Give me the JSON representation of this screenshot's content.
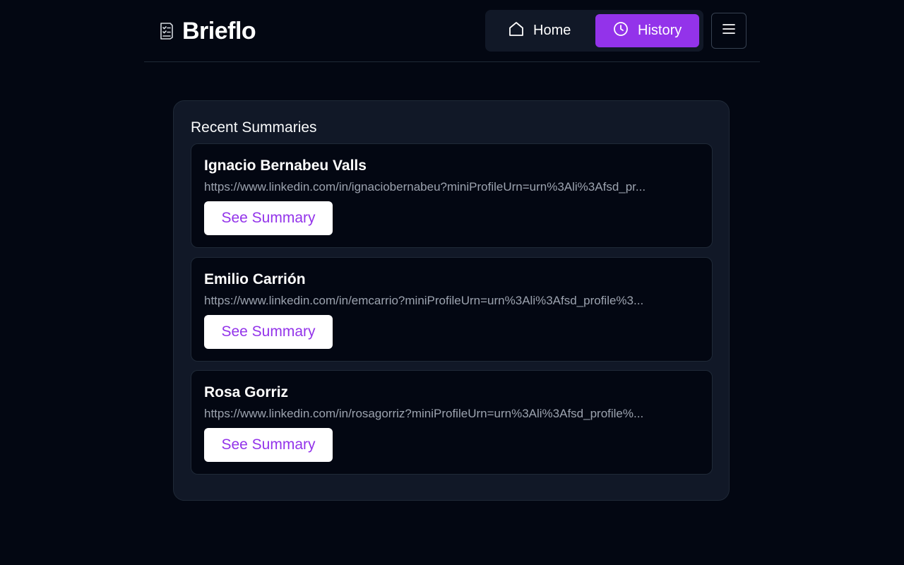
{
  "app": {
    "name": "Brieflo",
    "logo_icon": "note-list-icon"
  },
  "nav": {
    "home_label": "Home",
    "home_icon": "home-icon",
    "history_label": "History",
    "history_icon": "clock-icon",
    "menu_icon": "hamburger-menu-icon",
    "active": "History",
    "accent_color": "#9333ea"
  },
  "main": {
    "title": "Recent Summaries",
    "items": [
      {
        "name": "Ignacio Bernabeu Valls",
        "url": "https://www.linkedin.com/in/ignaciobernabeu?miniProfileUrn=urn%3Ali%3Afsd_pr...",
        "button_label": "See Summary"
      },
      {
        "name": "Emilio Carrión",
        "url": "https://www.linkedin.com/in/emcarrio?miniProfileUrn=urn%3Ali%3Afsd_profile%3...",
        "button_label": "See Summary"
      },
      {
        "name": "Rosa Gorriz",
        "url": "https://www.linkedin.com/in/rosagorriz?miniProfileUrn=urn%3Ali%3Afsd_profile%...",
        "button_label": "See Summary"
      }
    ]
  }
}
